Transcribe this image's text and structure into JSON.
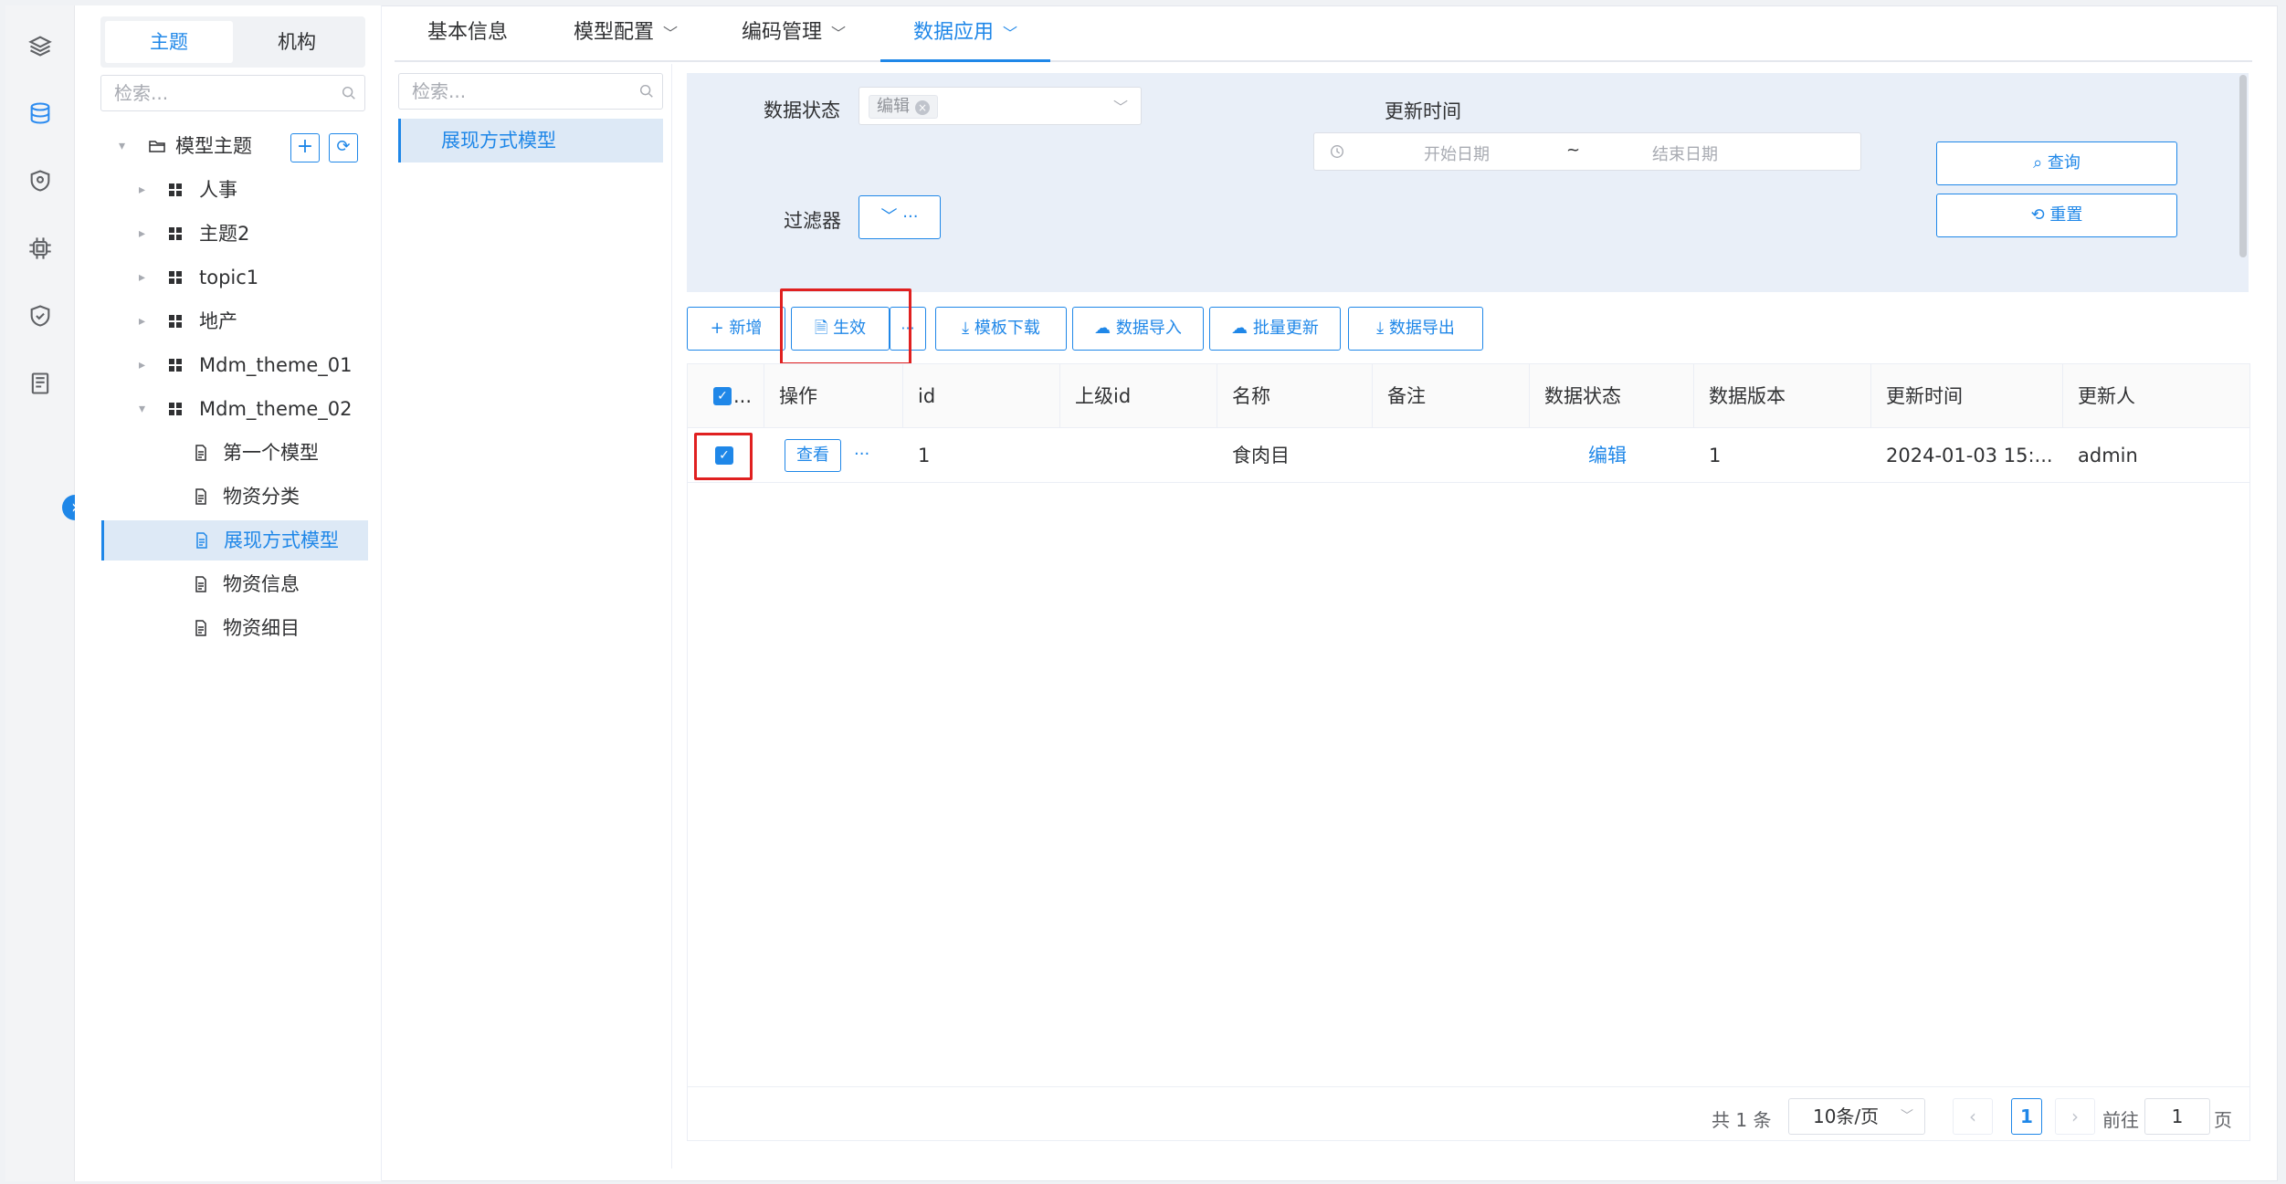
{
  "nav": {
    "segment_tabs": [
      "主题",
      "机构"
    ],
    "search_placeholder": "检索...",
    "tree": [
      {
        "label": "模型主题",
        "level": 0
      },
      {
        "label": "人事",
        "level": 1
      },
      {
        "label": "主题2",
        "level": 1
      },
      {
        "label": "topic1",
        "level": 1
      },
      {
        "label": "地产",
        "level": 1
      },
      {
        "label": "Mdm_theme_01",
        "level": 1
      },
      {
        "label": "Mdm_theme_02",
        "level": 1
      },
      {
        "label": "第一个模型",
        "level": 2
      },
      {
        "label": "物资分类",
        "level": 2
      },
      {
        "label": "展现方式模型",
        "level": 2,
        "selected": true
      },
      {
        "label": "物资信息",
        "level": 2
      },
      {
        "label": "物资细目",
        "level": 2
      }
    ]
  },
  "tabs": [
    "基本信息",
    "模型配置",
    "编码管理",
    "数据应用"
  ],
  "active_tab": "数据应用",
  "middle": {
    "search_placeholder": "检索...",
    "item": "展现方式模型"
  },
  "filters": {
    "status_label": "数据状态",
    "status_tag": "编辑",
    "update_time_label": "更新时间",
    "start_placeholder": "开始日期",
    "date_sep": "~",
    "end_placeholder": "结束日期",
    "filter_label": "过滤器",
    "query_button": "查询",
    "reset_button": "重置"
  },
  "toolbar": {
    "add": "新增",
    "effect": "生效",
    "more": "···",
    "template_download": "模板下载",
    "data_import": "数据导入",
    "batch_update": "批量更新",
    "data_export": "数据导出"
  },
  "table": {
    "select_header": "...",
    "columns": [
      "操作",
      "id",
      "上级id",
      "名称",
      "备注",
      "数据状态",
      "数据版本",
      "更新时间",
      "更新人"
    ],
    "rows": [
      {
        "view": "查看",
        "more": "···",
        "id": "1",
        "parent_id": "",
        "name": "食肉目",
        "remark": "",
        "status": "编辑",
        "version": "1",
        "update_time": "2024-01-03 15:...",
        "updater": "admin"
      }
    ]
  },
  "pagination": {
    "total": "共 1 条",
    "page_size": "10条/页",
    "current": "1",
    "goto_label": "前往",
    "goto_value": "1",
    "page_suffix": "页"
  },
  "colors": {
    "accent": "#1f87e8",
    "highlight": "#e02020",
    "filter_bg": "#e9eff8"
  }
}
